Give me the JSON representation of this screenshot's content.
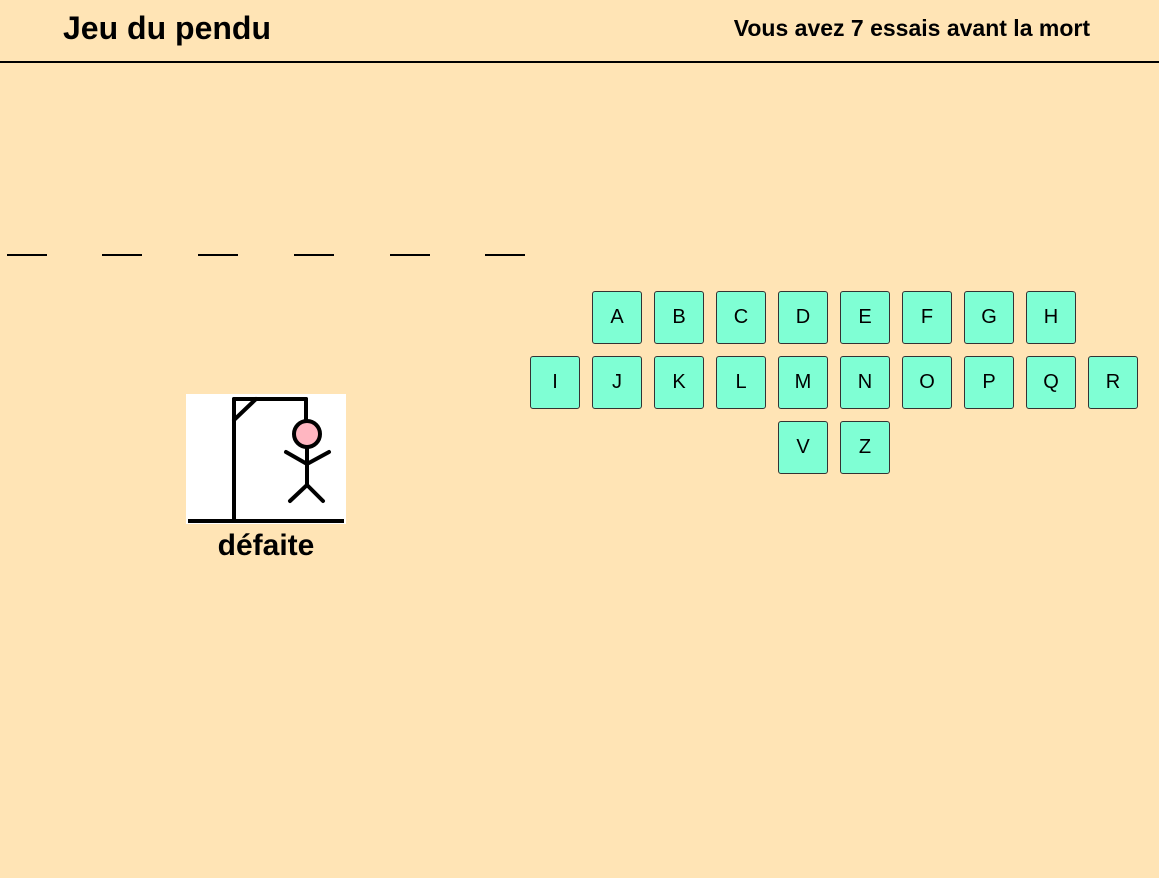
{
  "header": {
    "title": "Jeu du pendu",
    "tries_message": "Vous avez 7 essais avant la mort"
  },
  "word": {
    "slots": [
      "",
      "",
      "",
      "",
      "",
      ""
    ]
  },
  "hangman": {
    "status": "défaite",
    "icon": "hangman-gallows-icon"
  },
  "keyboard": {
    "row1": [
      "A",
      "B",
      "C",
      "D",
      "E",
      "F",
      "G",
      "H"
    ],
    "row2": [
      "I",
      "J",
      "K",
      "L",
      "M",
      "N",
      "O",
      "P",
      "Q",
      "R"
    ],
    "row3": [
      "V",
      "Z"
    ]
  },
  "colors": {
    "background": "#ffe4b5",
    "key_background": "#7fffd4",
    "head": "#ffb6c1"
  }
}
